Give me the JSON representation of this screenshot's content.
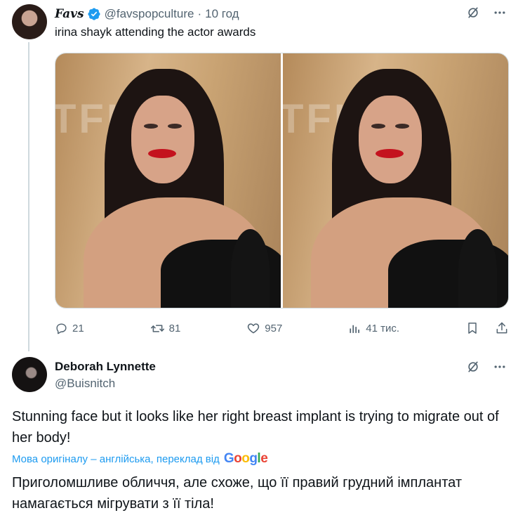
{
  "tweet": {
    "author_name": "Favs",
    "handle": "@favspopculture",
    "separator": "·",
    "time": "10 год",
    "text": "irina shayk attending the actor awards",
    "media_backdrop_text": [
      "TFLIX",
      "TFLIX"
    ],
    "stats": {
      "replies": "21",
      "reposts": "81",
      "likes": "957",
      "views": "41 тис."
    }
  },
  "reply": {
    "author_name": "Deborah Lynnette",
    "handle": "@Buisnitch",
    "text": "Stunning face but it looks like her right breast implant is trying to migrate out of her body!",
    "translation_note": "Мова оригіналу – англійська, переклад від",
    "translation_provider": "Google",
    "translated_text": "Приголомшливе обличчя, але схоже, що її правий грудний імплантат намагається мігрувати з її тіла!"
  },
  "colors": {
    "text_primary": "#0f1419",
    "text_muted": "#536471",
    "link_blue": "#1d9bf0",
    "verified_blue": "#1d9bf0",
    "divider": "#cfd9de"
  },
  "icons": [
    "verified-badge-icon",
    "grok-slash-icon",
    "more-icon",
    "reply-icon",
    "repost-icon",
    "like-icon",
    "views-icon",
    "bookmark-icon",
    "share-icon"
  ]
}
